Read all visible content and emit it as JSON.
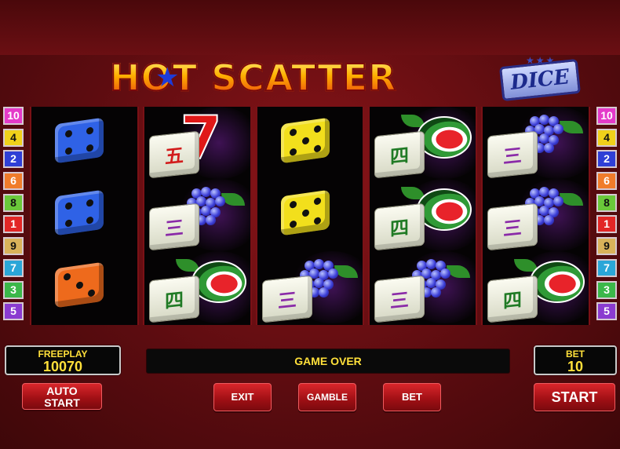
{
  "game": {
    "title_main": "HOT SCATTER",
    "title_sub": "DICE"
  },
  "paylines": {
    "left": [
      "10",
      "4",
      "2",
      "6",
      "8",
      "1",
      "9",
      "7",
      "3",
      "5"
    ],
    "right": [
      "10",
      "4",
      "2",
      "6",
      "8",
      "1",
      "9",
      "7",
      "3",
      "5"
    ],
    "colors": {
      "10": "#e43ac9",
      "4": "#f0d01a",
      "2": "#2f3fd6",
      "6": "#f07c2a",
      "8": "#6ac83a",
      "1": "#e22626",
      "9": "#d9b25a",
      "7": "#2aa6d8",
      "3": "#3bb84a",
      "5": "#8a3bd0"
    }
  },
  "reels": [
    [
      "dice-blue-4",
      "dice-blue-4",
      "dice-orange-3"
    ],
    [
      "seven-wu",
      "grapes-san",
      "melon-si"
    ],
    [
      "dice-yellow-5",
      "dice-yellow-5",
      "grapes-san"
    ],
    [
      "melon-si",
      "melon-si",
      "grapes-san"
    ],
    [
      "grapes-san",
      "grapes-san",
      "melon-si"
    ]
  ],
  "tiles": {
    "wu": "五",
    "san": "三",
    "si": "四"
  },
  "freeplay": {
    "label": "FREEPLAY",
    "value": "10070"
  },
  "bet": {
    "label": "BET",
    "value": "10"
  },
  "message": "GAME OVER",
  "buttons": {
    "auto_start_line1": "AUTO",
    "auto_start_line2": "START",
    "exit": "EXIT",
    "gamble": "GAMBLE",
    "bet": "BET",
    "start": "START"
  }
}
